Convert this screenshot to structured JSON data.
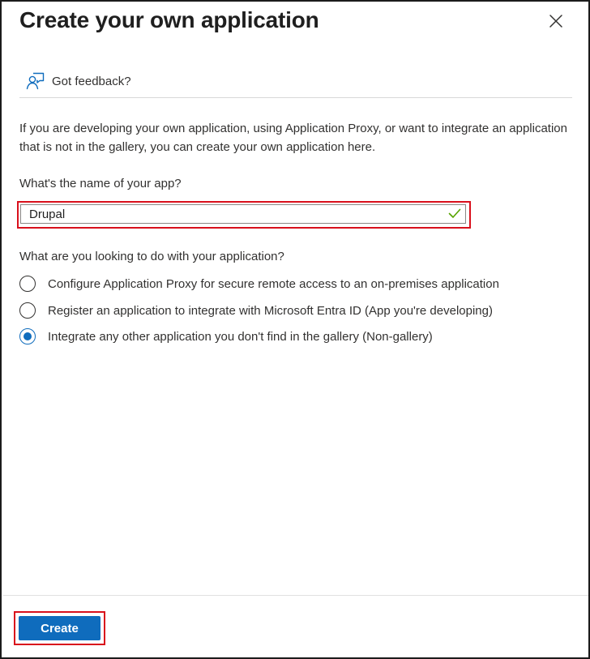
{
  "panel": {
    "title": "Create your own application",
    "close_icon": "close-icon"
  },
  "feedback": {
    "icon": "feedback-person-icon",
    "label": "Got feedback?"
  },
  "description": "If you are developing your own application, using Application Proxy, or want to integrate an application that is not in the gallery, you can create your own application here.",
  "app_name": {
    "label": "What's the name of your app?",
    "value": "Drupal",
    "valid_icon": "checkmark-icon",
    "valid_color": "#57a300"
  },
  "purpose": {
    "question": "What are you looking to do with your application?",
    "options": [
      {
        "label": "Configure Application Proxy for secure remote access to an on-premises application",
        "selected": false
      },
      {
        "label": "Register an application to integrate with Microsoft Entra ID (App you're developing)",
        "selected": false
      },
      {
        "label": "Integrate any other application you don't find in the gallery (Non-gallery)",
        "selected": true
      }
    ]
  },
  "footer": {
    "create_label": "Create"
  },
  "colors": {
    "accent": "#0f6cbd",
    "highlight": "#d9101c"
  }
}
